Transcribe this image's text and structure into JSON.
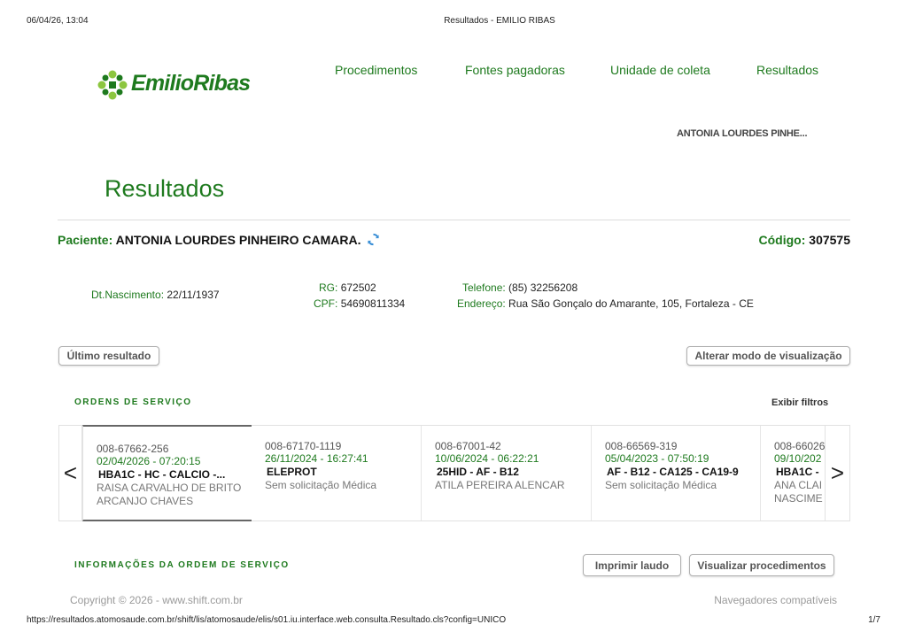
{
  "print_header": {
    "datetime": "06/04/26, 13:04",
    "title": "Resultados - EMILIO RIBAS"
  },
  "logo": {
    "text": "EmilioRibas",
    "icon": "green-cross-logo-icon"
  },
  "nav": {
    "items": [
      {
        "label": "Procedimentos"
      },
      {
        "label": "Fontes pagadoras"
      },
      {
        "label": "Unidade de coleta"
      },
      {
        "label": "Resultados"
      }
    ]
  },
  "user": {
    "name": "ANTONIA LOURDES PINHE..."
  },
  "page": {
    "title": "Resultados"
  },
  "patient": {
    "label": "Paciente:",
    "name": "ANTONIA LOURDES PINHEIRO CAMARA.",
    "refresh_icon": "refresh-icon",
    "code_label": "Código:",
    "code": "307575",
    "birth_label": "Dt.Nascimento:",
    "birth": "22/11/1937",
    "rg_label": "RG:",
    "rg": "672502",
    "cpf_label": "CPF:",
    "cpf": "54690811334",
    "phone_label": "Telefone:",
    "phone": "(85) 32256208",
    "address_label": "Endereço:",
    "address": "Rua São Gonçalo do Amarante, 105, Fortaleza - CE"
  },
  "buttons": {
    "last_result": "Último resultado",
    "change_view": "Alterar modo de visualização",
    "print_report": "Imprimir laudo",
    "view_procedures": "Visualizar procedimentos"
  },
  "orders": {
    "section_label": "ORDENS DE SERVIÇO",
    "filters_label": "Exibir filtros",
    "prev_arrow": "<",
    "next_arrow": ">",
    "items": [
      {
        "number": "008-67662-256",
        "date": "02/04/2026 - 07:20:15",
        "exams": "HBA1C - HC - CALCIO -...",
        "doctor": "RAISA CARVALHO DE BRITO ARCANJO CHAVES"
      },
      {
        "number": "008-67170-1119",
        "date": "26/11/2024 - 16:27:41",
        "exams": "ELEPROT",
        "doctor": "Sem solicitação Médica"
      },
      {
        "number": "008-67001-42",
        "date": "10/06/2024 - 06:22:21",
        "exams": "25HID - AF - B12",
        "doctor": "ATILA PEREIRA ALENCAR"
      },
      {
        "number": "008-66569-319",
        "date": "05/04/2023 - 07:50:19",
        "exams": "AF - B12 - CA125 - CA19-9",
        "doctor": "Sem solicitação Médica"
      },
      {
        "number": "008-66026",
        "date": "09/10/202",
        "exams": "HBA1C -",
        "doctor": "ANA CLAI NASCIME"
      }
    ]
  },
  "order_info": {
    "section_label": "INFORMAÇÕES DA ORDEM DE SERVIÇO"
  },
  "footer": {
    "copyright": "Copyright © 2026 - www.shift.com.br",
    "browsers": "Navegadores compatíveis"
  },
  "print_footer": {
    "url": "https://resultados.atomosaude.com.br/shift/lis/atomosaude/elis/s01.iu.interface.web.consulta.Resultado.cls?config=UNICO",
    "page": "1/7"
  },
  "colors": {
    "brand_green": "#1e7a1e",
    "logo_light_green": "#8cc63f",
    "refresh_blue": "#3a8fd6"
  }
}
